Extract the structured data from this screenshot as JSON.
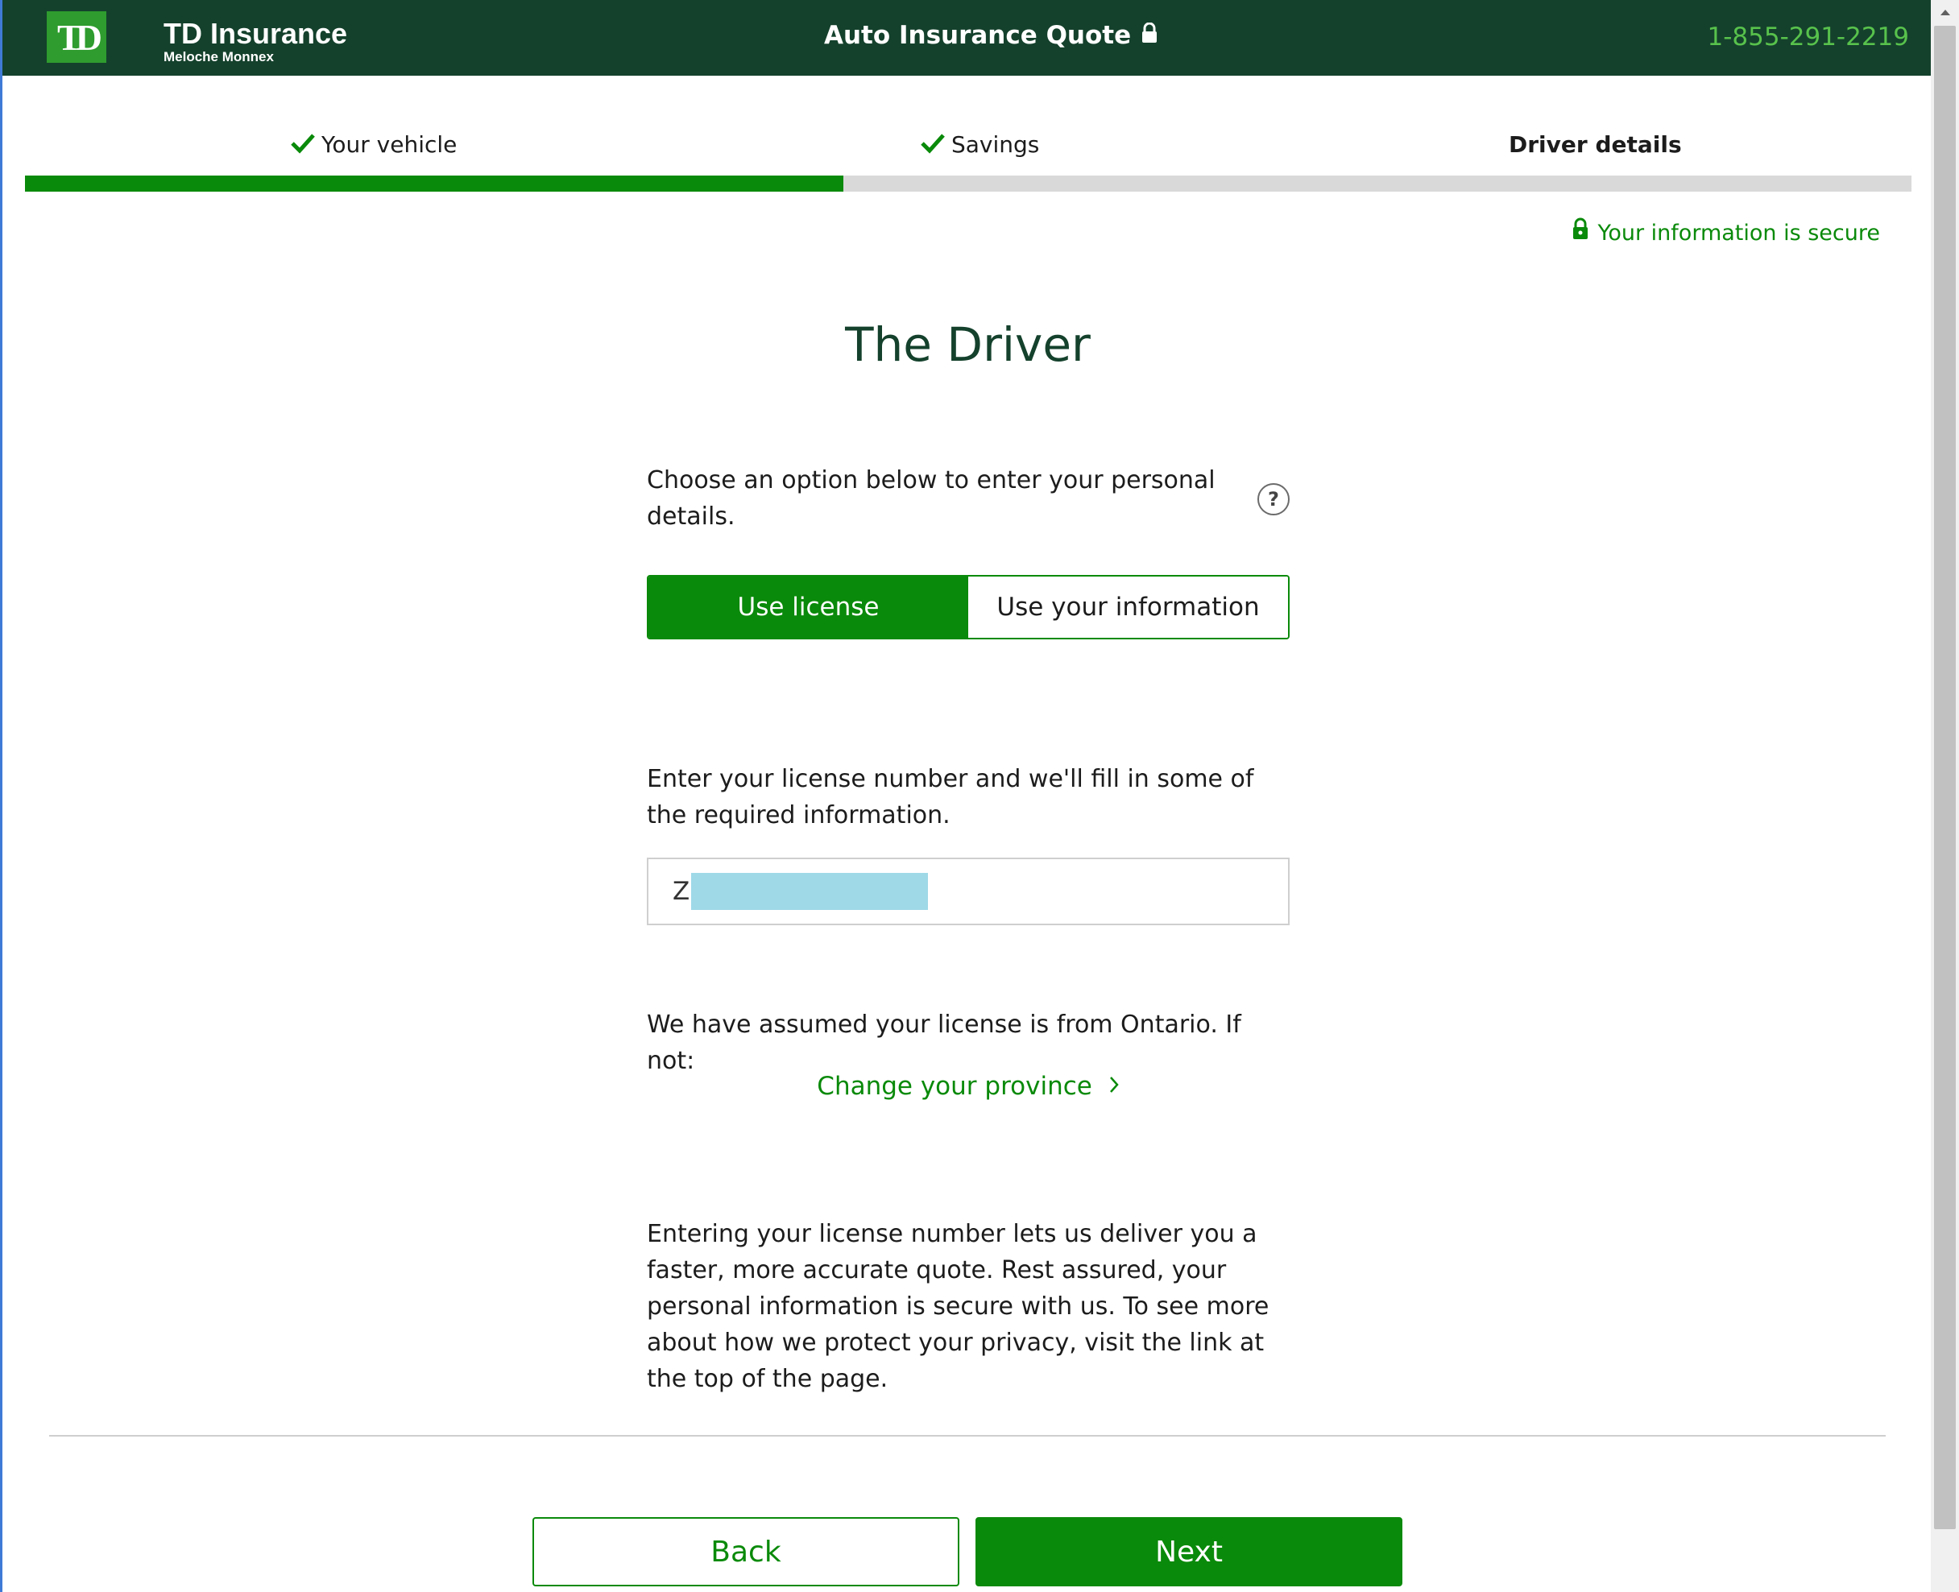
{
  "header": {
    "logo_mark": "TD",
    "brand": "TD Insurance",
    "sub_brand": "Meloche Monnex",
    "title": "Auto Insurance Quote",
    "phone": "1-855-291-2219"
  },
  "steps": {
    "items": [
      {
        "label": "Your vehicle",
        "status": "complete"
      },
      {
        "label": "Savings",
        "status": "complete"
      },
      {
        "label": "Driver details",
        "status": "current"
      }
    ],
    "progress": 0.434
  },
  "secure_text": "Your information is secure",
  "main": {
    "title": "The Driver",
    "choose_text": "Choose an option below to enter your personal details.",
    "help_glyph": "?",
    "toggle": {
      "options": [
        "Use license",
        "Use your information"
      ],
      "selected": "Use license"
    },
    "license_desc": "Enter your license number and we'll fill in some of the required information.",
    "license_value": "Z",
    "assume_text": "We have assumed your license is from Ontario. If not:",
    "change_province": "Change your province",
    "privacy_text": "Entering your license number lets us deliver you a faster, more accurate quote. Rest assured, your personal information is secure with us. To see more about how we protect your privacy, visit the link at the top of the page."
  },
  "buttons": {
    "back": "Back",
    "next": "Next"
  },
  "colors": {
    "header_bg": "#14412c",
    "accent_green": "#0a8a0a",
    "logo_green": "#2e9c2e",
    "phone_green": "#58c24c"
  }
}
